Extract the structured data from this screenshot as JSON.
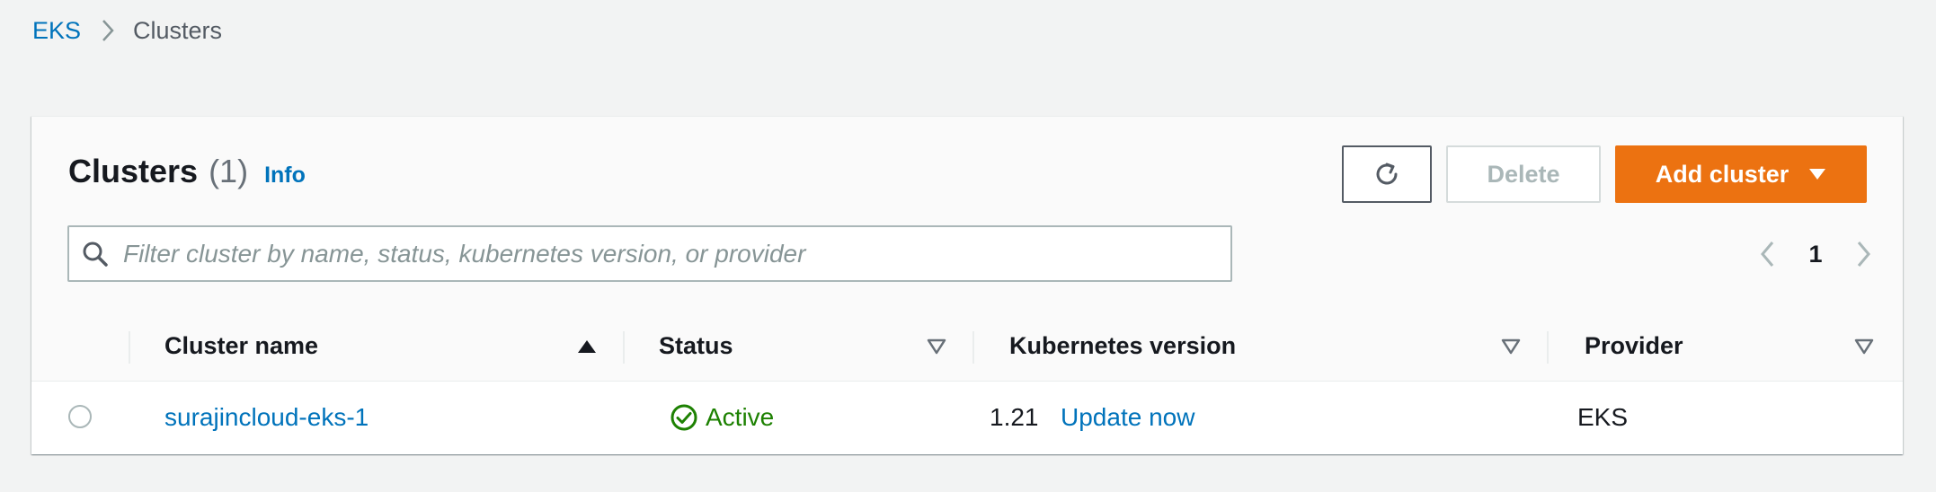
{
  "breadcrumb": {
    "root": "EKS",
    "current": "Clusters"
  },
  "panel": {
    "title": "Clusters",
    "count": "(1)",
    "info": "Info"
  },
  "toolbar": {
    "refresh_icon": "refresh-icon",
    "delete_label": "Delete",
    "add_label": "Add cluster"
  },
  "search": {
    "placeholder": "Filter cluster by name, status, kubernetes version, or provider",
    "value": ""
  },
  "pagination": {
    "page": "1"
  },
  "table": {
    "columns": [
      {
        "label": "Cluster name",
        "sort": "ascending"
      },
      {
        "label": "Status",
        "sort": "none"
      },
      {
        "label": "Kubernetes version",
        "sort": "none"
      },
      {
        "label": "Provider",
        "sort": "none"
      }
    ],
    "rows": [
      {
        "name": "surajincloud-eks-1",
        "status": "Active",
        "version": "1.21",
        "version_action": "Update now",
        "provider": "EKS"
      }
    ]
  },
  "colors": {
    "link": "#0073bb",
    "primary": "#ec7211",
    "success": "#1d8102",
    "background": "#f2f3f3"
  }
}
